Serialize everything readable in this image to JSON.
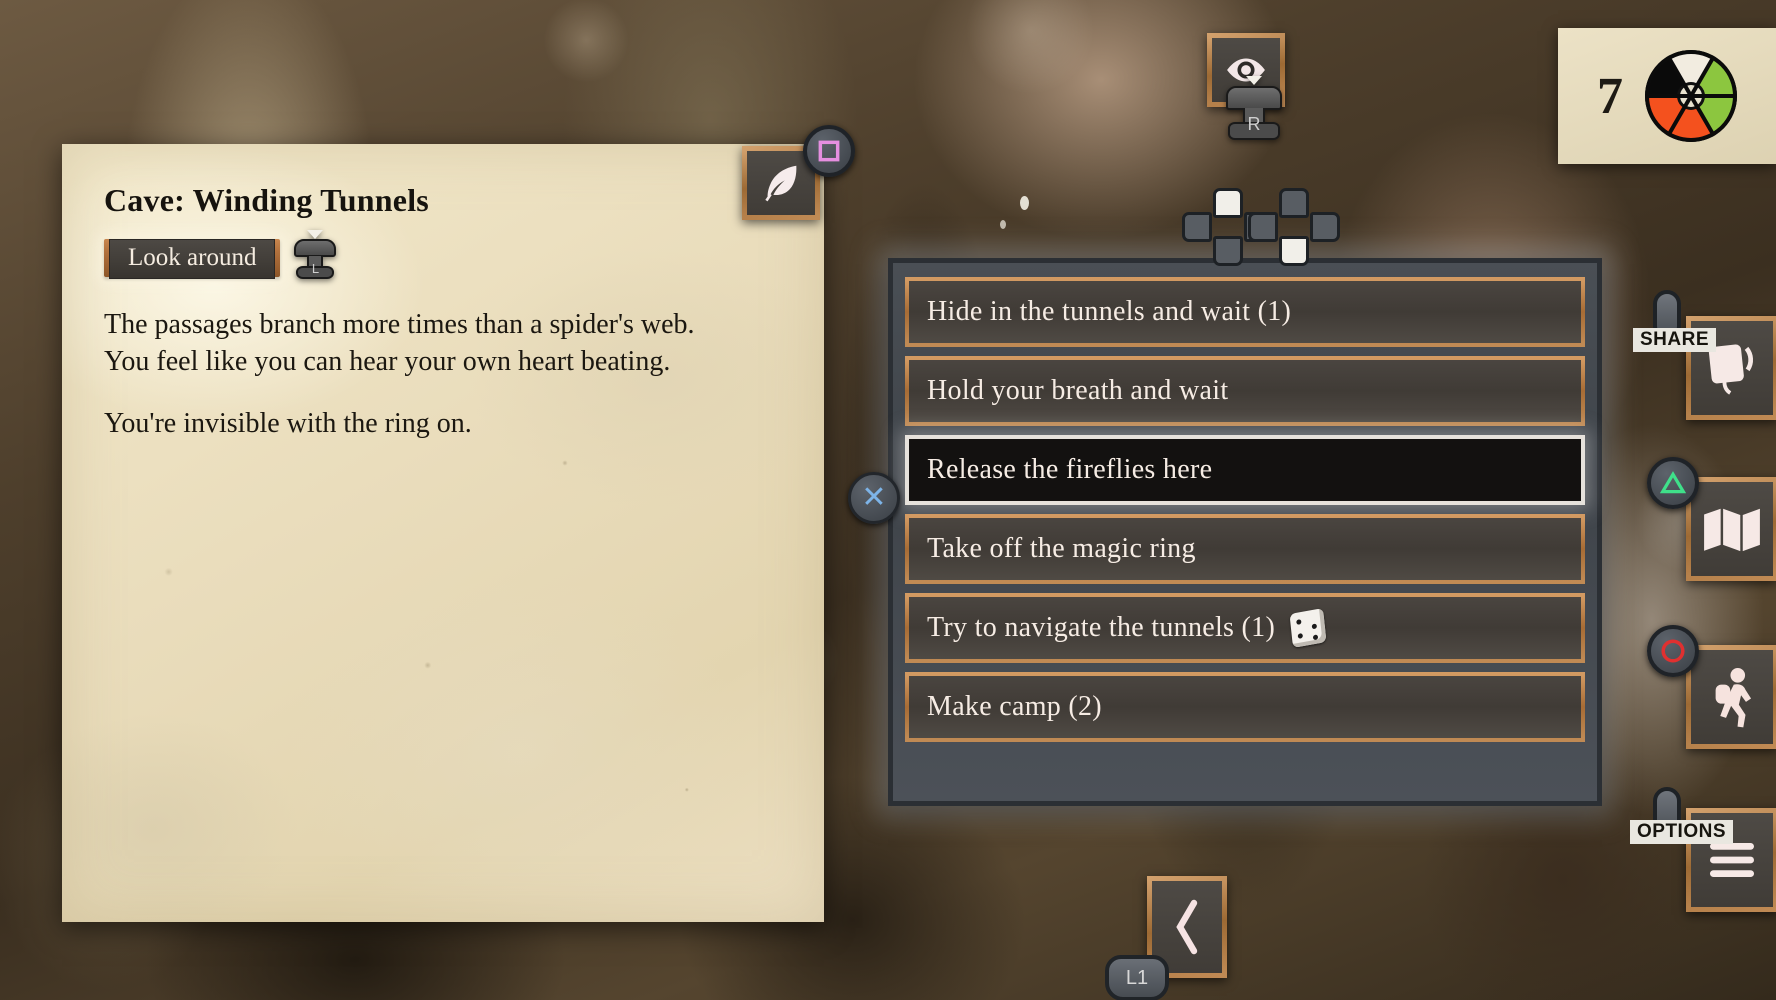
{
  "scene": {
    "title": "Cave: Winding Tunnels",
    "action_label": "Look around",
    "action_stick_label": "L",
    "paragraphs": [
      "The passages branch more times than a spider's web. You feel like you can hear your own heart beating.",
      "You're invisible with the ring on."
    ]
  },
  "choices": [
    {
      "label": "Hide in the tunnels and wait (1)",
      "selected": false,
      "dice": false
    },
    {
      "label": "Hold your breath and wait",
      "selected": false,
      "dice": false
    },
    {
      "label": "Release the fireflies here",
      "selected": true,
      "dice": false
    },
    {
      "label": "Take off the magic ring",
      "selected": false,
      "dice": false
    },
    {
      "label": "Try to navigate the tunnels (1)",
      "selected": false,
      "dice": true
    },
    {
      "label": "Make camp (2)",
      "selected": false,
      "dice": false
    }
  ],
  "close_button": {
    "glyph": "✕"
  },
  "hud": {
    "count": "7",
    "wheel_segments": [
      "#f2ece0",
      "#8cc63f",
      "#8cc63f",
      "#f4511e",
      "#f4511e",
      "#0a0a0a"
    ]
  },
  "controls": {
    "journal": {
      "icon": "quill-icon",
      "button": "square"
    },
    "look": {
      "icon": "eye-icon",
      "button": "R"
    },
    "share": {
      "icon": "journal-icon",
      "label": "SHARE"
    },
    "map": {
      "icon": "map-icon",
      "button": "triangle"
    },
    "travel": {
      "icon": "hiker-icon",
      "button": "circle"
    },
    "options": {
      "icon": "menu-icon",
      "label": "OPTIONS"
    },
    "back": {
      "icon": "chevron-left-icon",
      "label": "L1"
    },
    "dpad_left": {
      "highlight": "up"
    },
    "dpad_right": {
      "highlight": "down"
    }
  },
  "colors": {
    "wood_border": "#b0703c",
    "panel_bg": "#434850",
    "parchment": "#ece0c0",
    "selected_border": "#e6e2dc",
    "accent_blue": "#7db4e8",
    "accent_green": "#3fe08a",
    "accent_red": "#e03030",
    "accent_pink": "#e58fe0"
  }
}
